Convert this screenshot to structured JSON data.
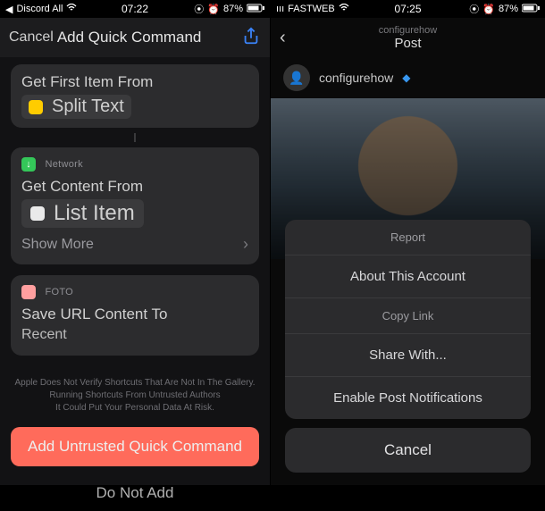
{
  "left": {
    "status": {
      "app": "Discord All",
      "wifi": "wifi-icon",
      "time": "07:22",
      "clock": "⦿",
      "alarm": "⏰",
      "battery_pct": "87%",
      "battery": "battery-icon"
    },
    "nav": {
      "cancel": "Cancel",
      "title": "Add Quick Command",
      "share": "share-icon"
    },
    "card1": {
      "line1": "Get First Item From",
      "icon_name": "text-icon",
      "pill": "Split Text"
    },
    "card2": {
      "app_icon": "download-icon",
      "app": "Network",
      "line1": "Get Content From",
      "pill_icon": "url-icon",
      "pill": "List Item",
      "show_more": "Show More",
      "chev": "›"
    },
    "card3": {
      "app_icon": "photo-icon",
      "app": "FOTO",
      "line1": "Save URL Content To",
      "line2": "Recent"
    },
    "warn": {
      "l1": "Apple Does Not Verify Shortcuts That Are Not In The Gallery.",
      "l2": "Running Shortcuts From Untrusted Authors",
      "l3": "It Could Put Your Personal Data At Risk."
    },
    "add_btn": "Add Untrusted Quick Command",
    "do_not": "Do Not Add"
  },
  "right": {
    "status": {
      "carrier": "FASTWEB",
      "time": "07:25",
      "clock": "⦿",
      "alarm": "⏰",
      "battery_pct": "87%",
      "battery": "battery-icon"
    },
    "nav": {
      "back": "‹",
      "sub": "configurehow",
      "title": "Post"
    },
    "user": {
      "avatar": "avatar",
      "name": "configurehow",
      "verified": "◆"
    },
    "sheet": {
      "report": "Report",
      "about": "About This Account",
      "copy": "Copy Link",
      "share": "Share With...",
      "notif": "Enable Post Notifications",
      "cancel": "Cancel"
    }
  }
}
